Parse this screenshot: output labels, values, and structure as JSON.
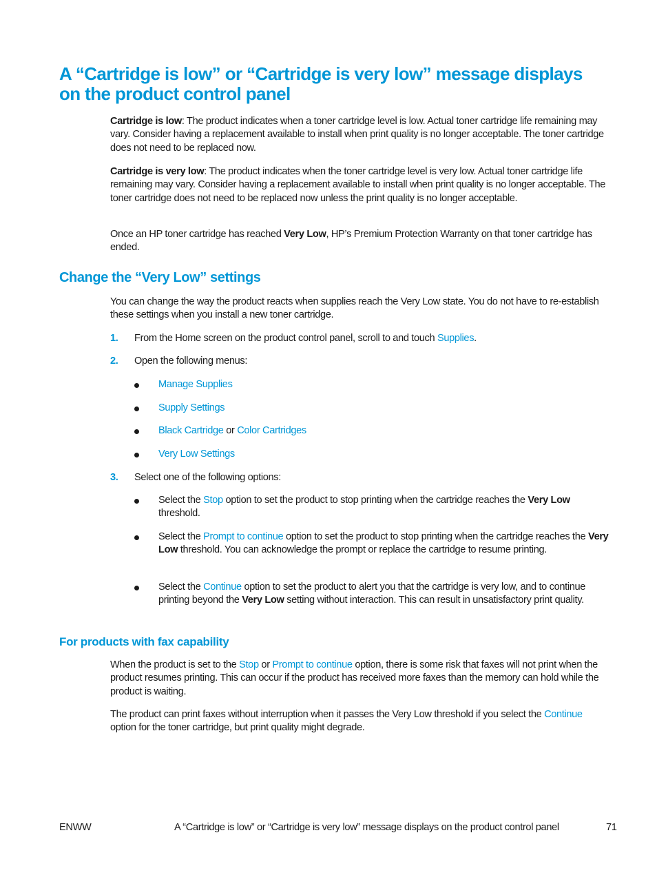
{
  "title": {
    "line1": "A “Cartridge is low” or “Cartridge is very low” message displays",
    "line2": "on the product control panel"
  },
  "intro": {
    "p1": {
      "bold": "Cartridge is low",
      "text": ": The product indicates when a toner cartridge level is low. Actual toner cartridge life remaining may vary. Consider having a replacement available to install when print quality is no longer acceptable. The toner cartridge does not need to be replaced now."
    },
    "p2": {
      "bold": "Cartridge is very low",
      "text": ": The product indicates when the toner cartridge level is very low. Actual toner cartridge life remaining may vary. Consider having a replacement available to install when print quality is no longer acceptable. The toner cartridge does not need to be replaced now unless the print quality is no longer acceptable."
    },
    "p3": {
      "before": "Once an HP toner cartridge has reached ",
      "bold": "Very Low",
      "after": ", HP’s Premium Protection Warranty on that toner cartridge has ended."
    }
  },
  "section": {
    "heading": "Change the “Very Low” settings",
    "intro": "You can change the way the product reacts when supplies reach the Very Low state. You do not have to re-establish these settings when you install a new toner cartridge.",
    "steps": [
      {
        "num": "1.",
        "before": "From the Home screen on the product control panel, scroll to and touch ",
        "link": "Supplies",
        "after": "."
      },
      {
        "num": "2.",
        "text": "Open the following menus:"
      },
      {
        "num": "3.",
        "text": "Select one of the following options:"
      }
    ],
    "menus": [
      {
        "link": "Manage Supplies"
      },
      {
        "link": "Supply Settings"
      },
      {
        "link": "Black Cartridge",
        "mid": " or ",
        "link2": "Color Cartridges"
      },
      {
        "link": "Very Low Settings"
      }
    ],
    "options": [
      {
        "before": "Select the ",
        "link": "Stop",
        "mid": " option to set the product to stop printing when the cartridge reaches the ",
        "bold": "Very Low",
        "after": " threshold."
      },
      {
        "before": "Select the ",
        "link": "Prompt to continue",
        "mid": " option to set the product to stop printing when the cartridge reaches the ",
        "bold": "Very Low",
        "after": " threshold. You can acknowledge the prompt or replace the cartridge to resume printing."
      },
      {
        "before": "Select the ",
        "link": "Continue",
        "mid": " option to set the product to alert you that the cartridge is very low, and to continue printing beyond the ",
        "bold": "Very Low",
        "after": " setting without interaction. This can result in unsatisfactory print quality."
      }
    ]
  },
  "fax": {
    "heading": "For products with fax capability",
    "p1": {
      "before": "When the product is set to the ",
      "link1": "Stop",
      "mid": " or ",
      "link2": "Prompt to continue",
      "after": " option, there is some risk that faxes will not print when the product resumes printing. This can occur if the product has received more faxes than the memory can hold while the product is waiting."
    },
    "p2": {
      "before": "The product can print faxes without interruption when it passes the Very Low threshold if you select the ",
      "link": "Continue",
      "after": " option for the toner cartridge, but print quality might degrade."
    }
  },
  "footer": {
    "left": "ENWW",
    "center": "A “Cartridge is low” or “Cartridge is very low” message displays on the product control panel",
    "page": "71"
  },
  "colors": {
    "accent": "#0096d6",
    "text": "#1a1a1a"
  }
}
